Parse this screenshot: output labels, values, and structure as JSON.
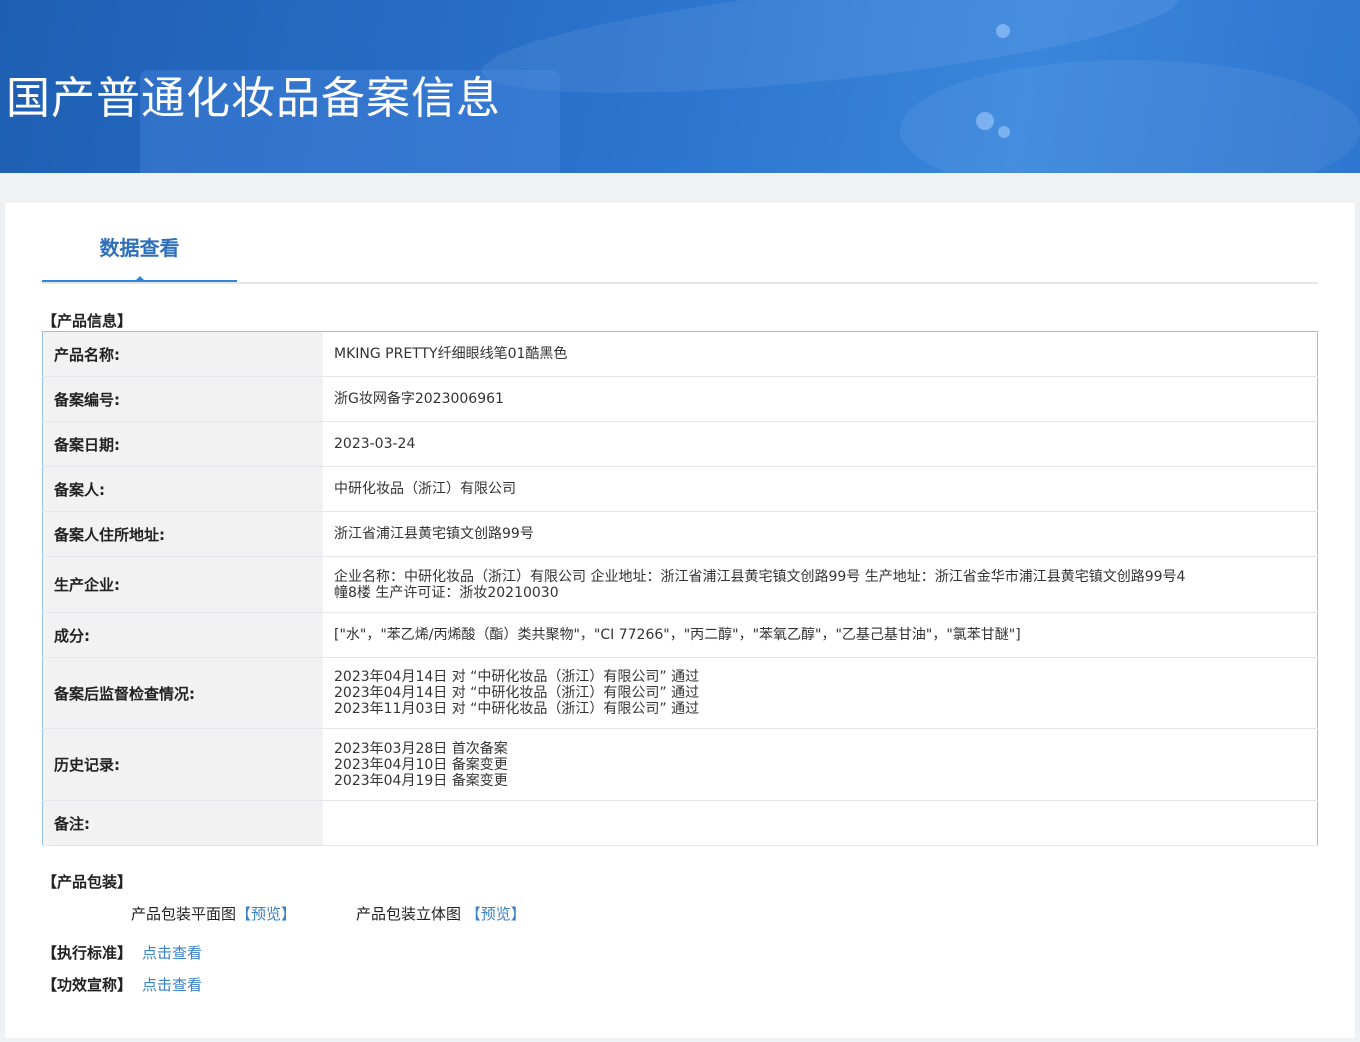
{
  "header": {
    "title": "国产普通化妆品备案信息"
  },
  "tabs": [
    {
      "label": "数据查看"
    }
  ],
  "product_info": {
    "section_title": "【产品信息】",
    "rows": [
      {
        "label": "产品名称:",
        "lines": [
          "MKING PRETTY纤细眼线笔01酷黑色"
        ]
      },
      {
        "label": "备案编号:",
        "lines": [
          "浙G妆网备字2023006961"
        ]
      },
      {
        "label": "备案日期:",
        "lines": [
          "2023-03-24"
        ]
      },
      {
        "label": "备案人:",
        "lines": [
          "中研化妆品（浙江）有限公司"
        ]
      },
      {
        "label": "备案人住所地址:",
        "lines": [
          "浙江省浦江县黄宅镇文创路99号"
        ]
      },
      {
        "label": "生产企业:",
        "lines": [
          "企业名称：中研化妆品（浙江）有限公司 企业地址：浙江省浦江县黄宅镇文创路99号 生产地址：浙江省金华市浦江县黄宅镇文创路99号4",
          "幢8楼 生产许可证：浙妆20210030"
        ]
      },
      {
        "label": "成分:",
        "lines": [
          "[\"水\"，\"苯乙烯/丙烯酸（酯）类共聚物\"，\"CI 77266\"，\"丙二醇\"，\"苯氧乙醇\"，\"乙基己基甘油\"，\"氯苯甘醚\"]"
        ]
      },
      {
        "label": "备案后监督检查情况:",
        "lines": [
          "2023年04月14日 对 “中研化妆品（浙江）有限公司” 通过",
          "2023年04月14日 对 “中研化妆品（浙江）有限公司” 通过",
          "2023年11月03日 对 “中研化妆品（浙江）有限公司” 通过"
        ]
      },
      {
        "label": "历史记录:",
        "lines": [
          "2023年03月28日 首次备案",
          "2023年04月10日 备案变更",
          "2023年04月19日 备案变更"
        ]
      },
      {
        "label": "备注:",
        "lines": []
      }
    ]
  },
  "packaging": {
    "section_title": "【产品包装】",
    "flat_label": "产品包装平面图",
    "flat_link": "【预览】",
    "solid_label": "产品包装立体图",
    "solid_link": "【预览】"
  },
  "standard": {
    "label": "【执行标准】",
    "link": "点击查看"
  },
  "efficacy": {
    "label": "【功效宣称】",
    "link": "点击查看"
  }
}
